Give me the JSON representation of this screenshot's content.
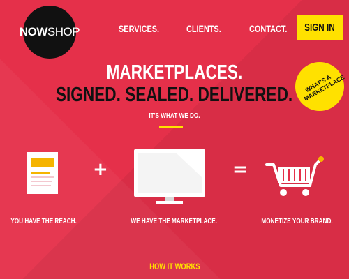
{
  "brand": {
    "logo_now": "NOW",
    "logo_shop": "SHOP"
  },
  "nav": {
    "items": [
      {
        "label": "SERVICES."
      },
      {
        "label": "CLIENTS."
      },
      {
        "label": "CONTACT."
      }
    ],
    "signin_label": "SIGN IN"
  },
  "hero": {
    "line1": "MARKETPLACES.",
    "line2": "SIGNED. SEALED. DELIVERED.",
    "tagline": "IT'S WHAT WE DO."
  },
  "badge": {
    "label": "WHAT'S A MARKETPLACE"
  },
  "steps": [
    {
      "icon": "document-icon",
      "caption": "YOU HAVE THE REACH."
    },
    {
      "icon": "monitor-icon",
      "caption": "WE HAVE THE MARKETPLACE."
    },
    {
      "icon": "shopping-cart-icon",
      "caption": "MONETIZE YOUR BRAND."
    }
  ],
  "operators": {
    "plus": "+",
    "equals": "="
  },
  "footer": {
    "how_it_works": "HOW IT WORKS"
  },
  "colors": {
    "background": "#e5304a",
    "accent_yellow": "#ffe100",
    "logo_black": "#111111",
    "text_white": "#ffffff"
  }
}
